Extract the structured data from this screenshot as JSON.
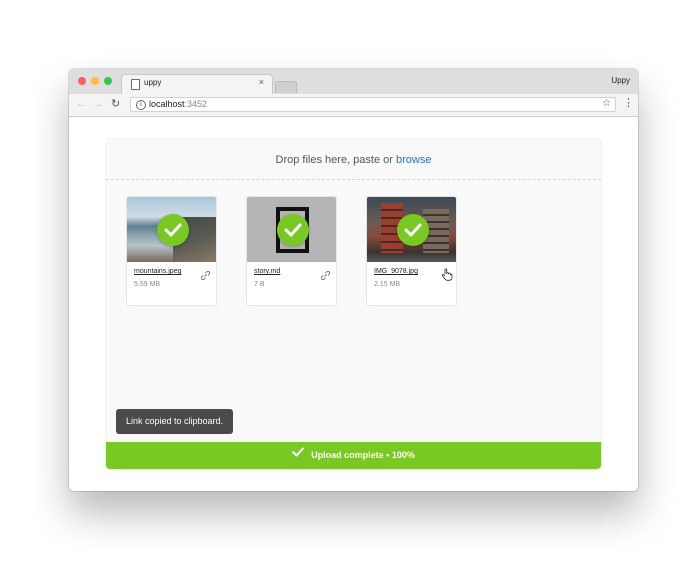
{
  "browser": {
    "tab_title": "uppy",
    "tab_close": "×",
    "profile_name": "Uppy",
    "url_host": "localhost",
    "url_port": ":3452",
    "nav": {
      "back": "←",
      "forward": "→",
      "reload": "↻",
      "star": "☆",
      "menu": "⋮"
    }
  },
  "dashboard": {
    "drop_text": "Drop files here, paste or",
    "browse_label": "browse",
    "files": [
      {
        "name": "mountains.jpeg",
        "size": "5.59 MB",
        "action_icon": "link-icon"
      },
      {
        "name": "story.md",
        "size": "7 B",
        "action_icon": "link-icon"
      },
      {
        "name": "IMG_9078.jpg",
        "size": "2.15 MB",
        "action_icon": "pointer-hand-icon"
      }
    ],
    "toast": "Link copied to clipboard.",
    "status": "Upload complete • 100%",
    "progress_percent": 100
  },
  "colors": {
    "accent_green": "#7ac824",
    "browse_blue": "#2275d7",
    "toast_bg": "#4a4a4a"
  }
}
